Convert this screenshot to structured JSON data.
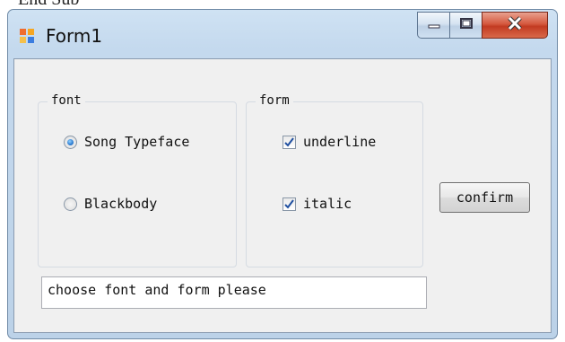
{
  "background_text": "End Sub",
  "window": {
    "title": "Form1",
    "caption_buttons": [
      "minimize-icon",
      "maximize-icon",
      "close-icon"
    ]
  },
  "font_group": {
    "legend": "font",
    "options": [
      {
        "label": "Song Typeface",
        "checked": true
      },
      {
        "label": "Blackbody",
        "checked": false
      }
    ]
  },
  "form_group": {
    "legend": "form",
    "options": [
      {
        "label": "underline",
        "checked": true
      },
      {
        "label": "italic",
        "checked": true
      }
    ]
  },
  "confirm_button": {
    "label": "confirm"
  },
  "status_box": {
    "value": "choose font and form please"
  },
  "colors": {
    "accent": "#1f6fc9",
    "close_button": "#c23b22"
  }
}
